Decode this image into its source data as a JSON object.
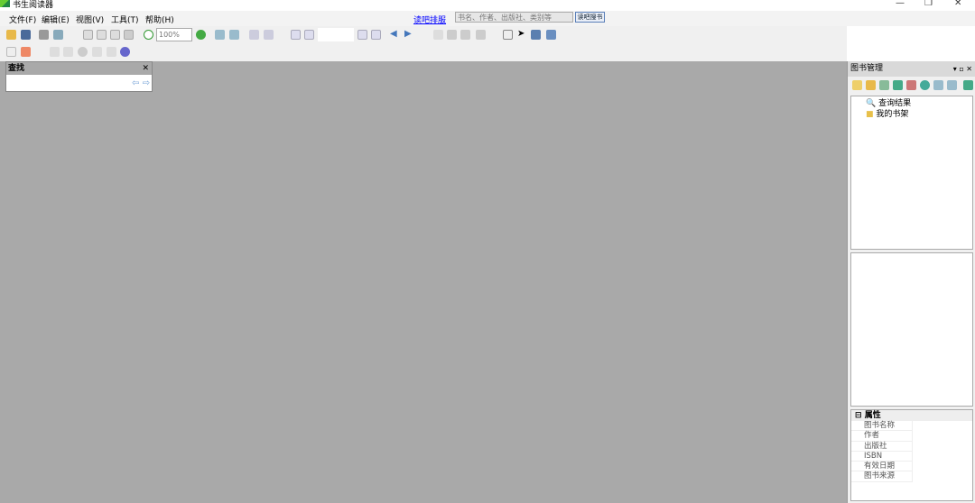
{
  "window": {
    "title": "书生阅读器"
  },
  "menu": [
    "文件(F)",
    "编辑(E)",
    "视图(V)",
    "工具(T)",
    "帮助(H)"
  ],
  "top_link": "读吧排服",
  "search": {
    "placeholder": "书名、作者、出版社、类别等",
    "button": "读吧搜书"
  },
  "toolbar": {
    "zoom": "100%"
  },
  "find_panel": {
    "title": "查找"
  },
  "right_panel": {
    "title": "图书管理",
    "tree": [
      "查询结果",
      "我的书架"
    ],
    "properties": {
      "header": "属性",
      "rows": [
        "图书名称",
        "作者",
        "出版社",
        "ISBN",
        "有效日期",
        "图书来源"
      ]
    }
  }
}
